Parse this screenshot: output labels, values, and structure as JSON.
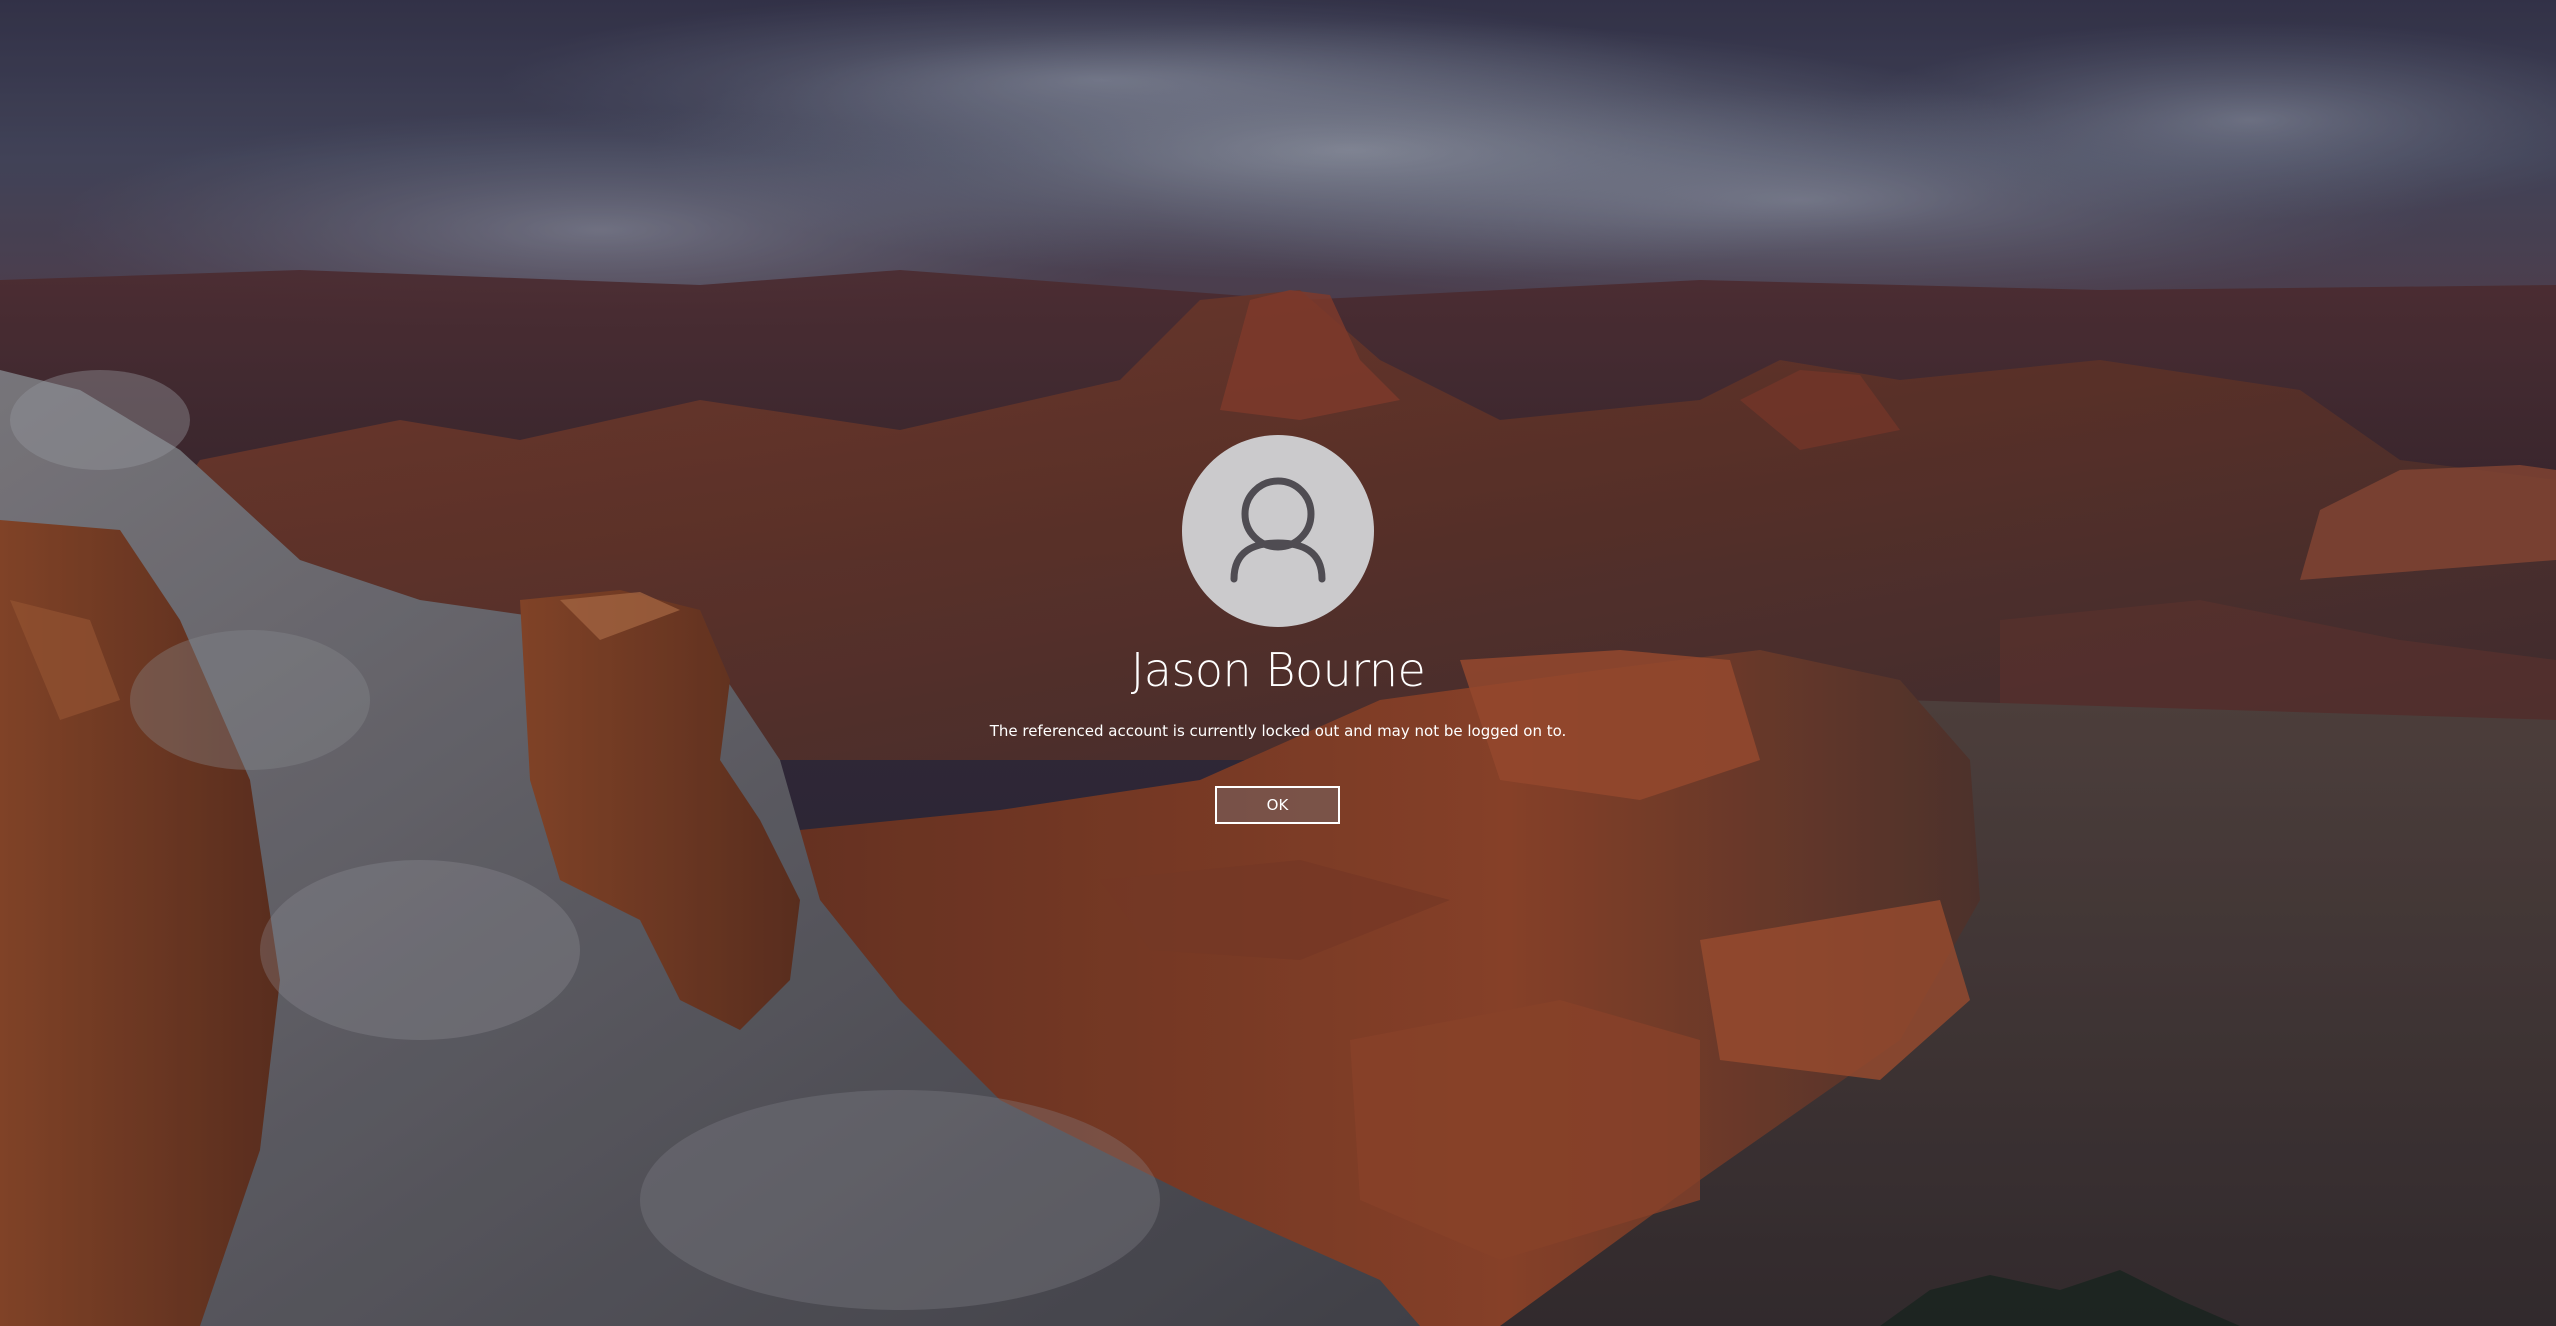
{
  "lock_screen": {
    "user_name": "Jason Bourne",
    "message": "The referenced account is currently locked out and may not be logged on to.",
    "ok_label": "OK"
  },
  "avatar": {
    "icon": "user-silhouette-icon"
  },
  "colors": {
    "text": "#ffffff",
    "avatar_background": "#cbcacc",
    "avatar_glyph": "#4f4c52",
    "button_border": "#ffffff"
  }
}
